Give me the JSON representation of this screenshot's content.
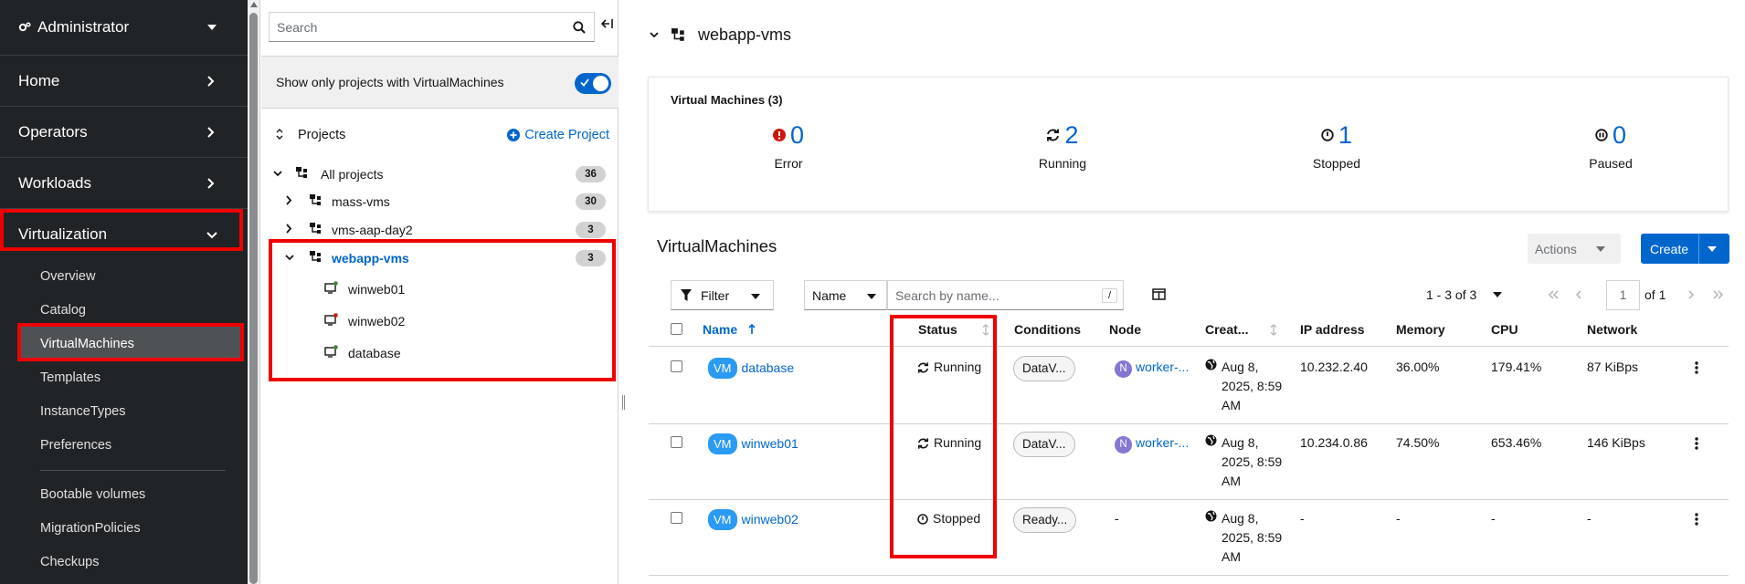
{
  "nav": {
    "perspective": "Administrator",
    "sections": [
      "Home",
      "Operators",
      "Workloads",
      "Virtualization"
    ],
    "subitems": [
      "Overview",
      "Catalog",
      "VirtualMachines",
      "Templates",
      "InstanceTypes",
      "Preferences",
      "Bootable volumes",
      "MigrationPolicies",
      "Checkups"
    ],
    "active_subitem": "VirtualMachines"
  },
  "tree": {
    "search_placeholder": "Search",
    "toggle_label": "Show only projects with VirtualMachines",
    "toggle_on": true,
    "projects_label": "Projects",
    "create_project": "Create Project",
    "rows": [
      {
        "name": "All projects",
        "count": "36"
      },
      {
        "name": "mass-vms",
        "count": "30"
      },
      {
        "name": "vms-aap-day2",
        "count": "3"
      },
      {
        "name": "webapp-vms",
        "count": "3"
      }
    ],
    "vms": [
      "winweb01",
      "winweb02",
      "database"
    ]
  },
  "content": {
    "project_title": "webapp-vms",
    "summary_title": "Virtual Machines (3)",
    "stats": [
      {
        "value": "0",
        "label": "Error",
        "icon": "error-circle-icon",
        "color": "#c9190b"
      },
      {
        "value": "2",
        "label": "Running",
        "icon": "sync-icon",
        "color": "#151515"
      },
      {
        "value": "1",
        "label": "Stopped",
        "icon": "off-icon",
        "color": "#151515"
      },
      {
        "value": "0",
        "label": "Paused",
        "icon": "pause-circle-icon",
        "color": "#151515"
      }
    ],
    "section_title": "VirtualMachines",
    "actions_label": "Actions",
    "create_label": "Create",
    "filter_label": "Filter",
    "name_select": "Name",
    "search_placeholder": "Search by name...",
    "search_kbd": "/",
    "pagination": {
      "range": "1 - 3 of 3",
      "page": "1",
      "of": "of 1"
    },
    "columns": [
      "Name",
      "Status",
      "Conditions",
      "Node",
      "Creat...",
      "IP address",
      "Memory",
      "CPU",
      "Network"
    ],
    "vm_badge": "VM",
    "rows": [
      {
        "name": "database",
        "status": "Running",
        "condition": "DataV...",
        "node": "worker-...",
        "node_badge": "N",
        "created": [
          "Aug 8,",
          "2025, 8:59",
          "AM"
        ],
        "ip": "10.232.2.40",
        "memory": "36.00%",
        "cpu": "179.41%",
        "network": "87 KiBps"
      },
      {
        "name": "winweb01",
        "status": "Running",
        "condition": "DataV...",
        "node": "worker-...",
        "node_badge": "N",
        "created": [
          "Aug 8,",
          "2025, 8:59",
          "AM"
        ],
        "ip": "10.234.0.86",
        "memory": "74.50%",
        "cpu": "653.46%",
        "network": "146 KiBps"
      },
      {
        "name": "winweb02",
        "status": "Stopped",
        "condition": "Ready...",
        "node": "-",
        "node_badge": "",
        "created": [
          "Aug 8,",
          "2025, 8:59",
          "AM"
        ],
        "ip": "-",
        "memory": "-",
        "cpu": "-",
        "network": "-"
      }
    ]
  },
  "colors": {
    "brand": "#0066cc",
    "highlight": "#ee0000",
    "nav_bg": "#212427"
  }
}
